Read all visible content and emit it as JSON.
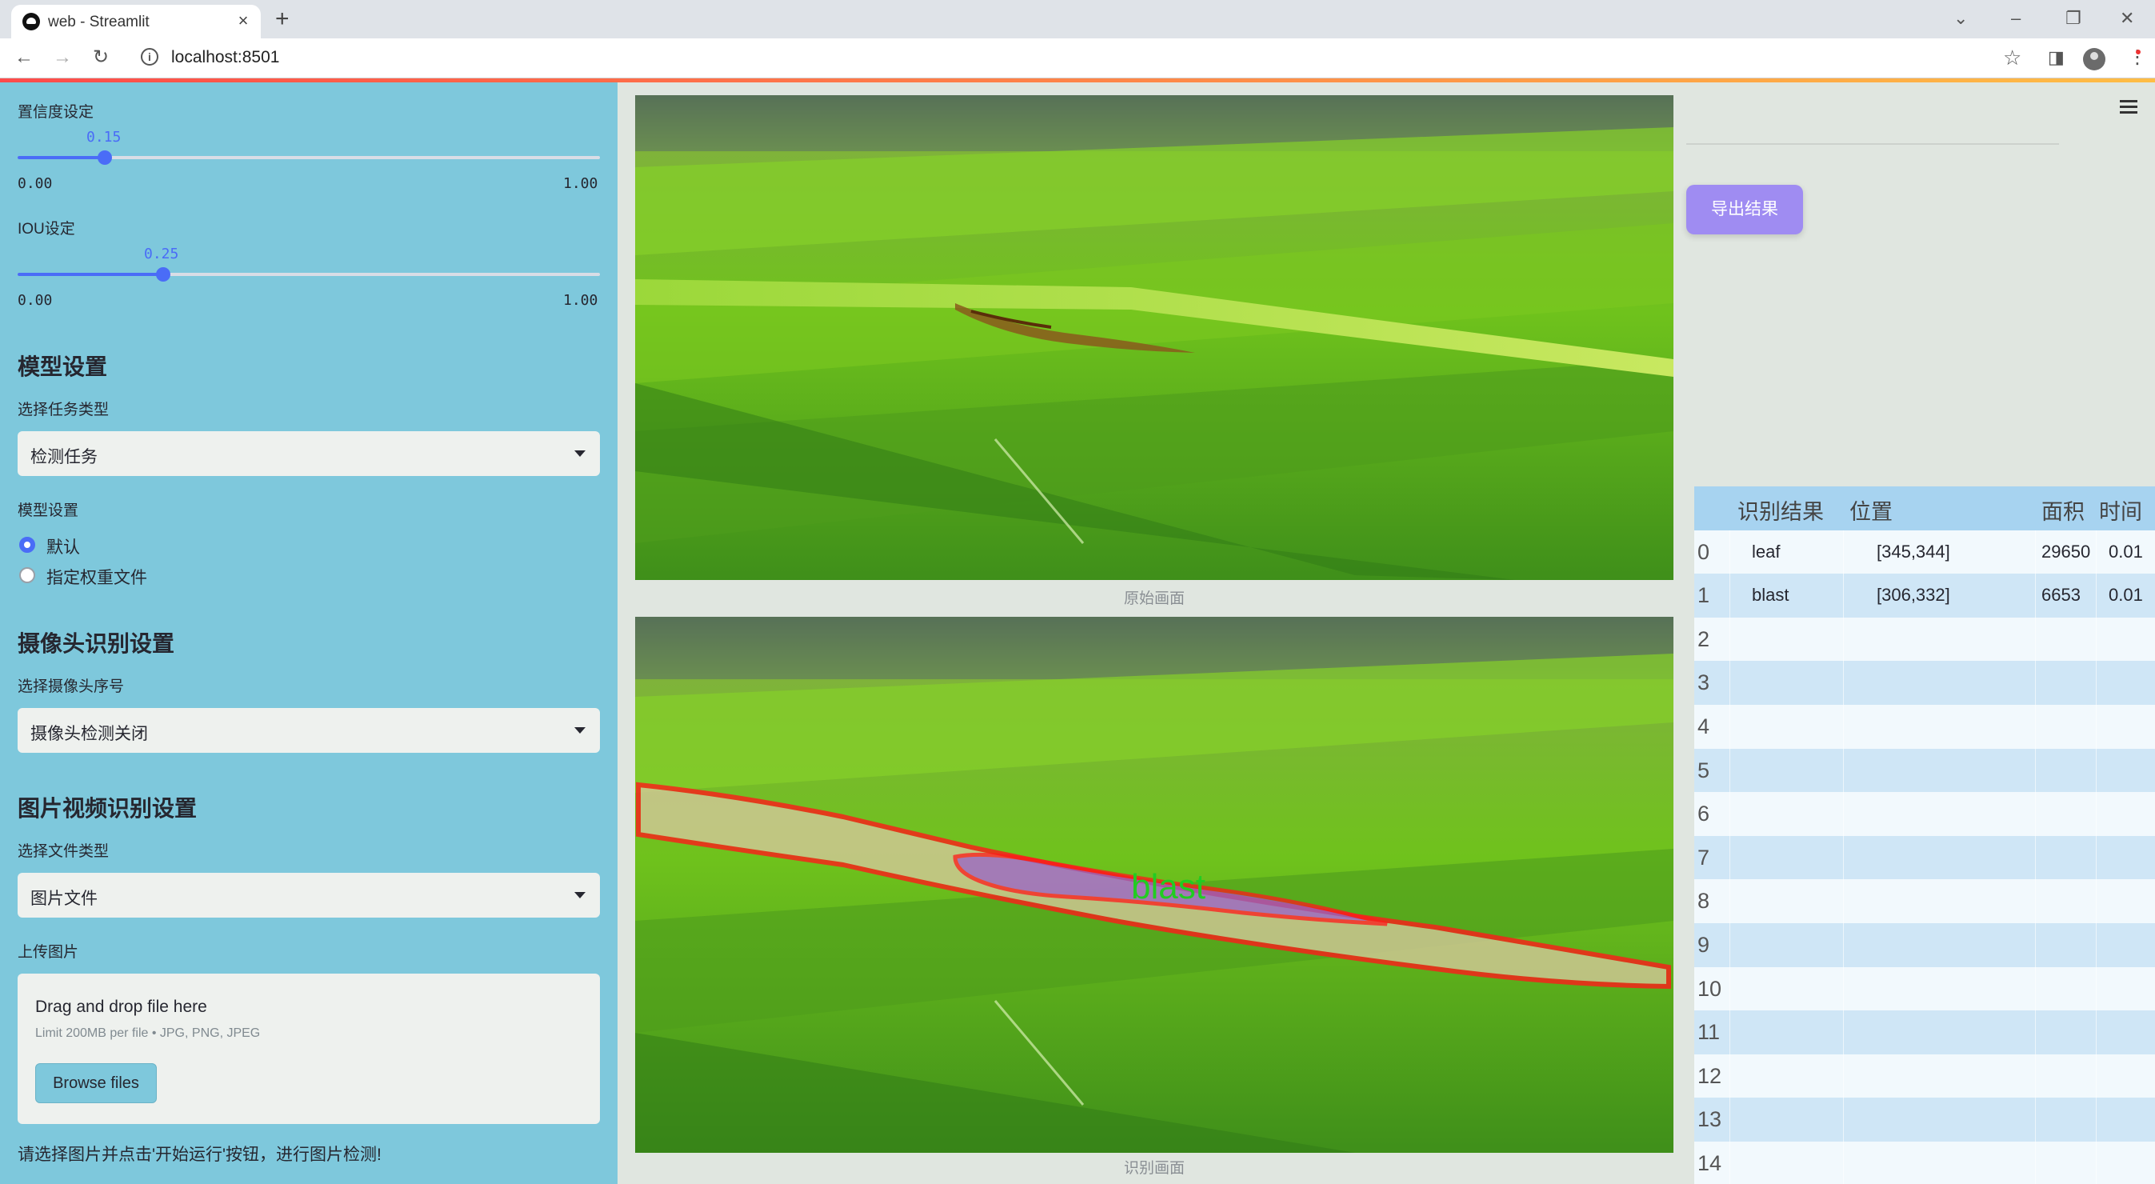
{
  "browser": {
    "tab_title": "web - Streamlit",
    "tab_close": "×",
    "new_tab": "+",
    "url": "localhost:8501",
    "minimize": "–",
    "restore": "❐",
    "close": "✕",
    "tab_list": "⌄"
  },
  "sidebar": {
    "confidence": {
      "label": "置信度设定",
      "value": "0.15",
      "value_fraction": 0.15,
      "min": "0.00",
      "max": "1.00"
    },
    "iou": {
      "label": "IOU设定",
      "value": "0.25",
      "value_fraction": 0.25,
      "min": "0.00",
      "max": "1.00"
    },
    "model_section": "模型设置",
    "task_type_label": "选择任务类型",
    "task_type_value": "检测任务",
    "model_settings_label": "模型设置",
    "model_options": [
      "默认",
      "指定权重文件"
    ],
    "model_selected": "默认",
    "camera_section": "摄像头识别设置",
    "camera_label": "选择摄像头序号",
    "camera_value": "摄像头检测关闭",
    "media_section": "图片视频识别设置",
    "file_type_label": "选择文件类型",
    "file_type_value": "图片文件",
    "upload_label": "上传图片",
    "upload_title": "Drag and drop file here",
    "upload_limit": "Limit 200MB per file • JPG, PNG, JPEG",
    "browse_button": "Browse files",
    "hint": "请选择图片并点击'开始运行'按钮，进行图片检测!"
  },
  "main": {
    "original_caption": "原始画面",
    "result_caption": "识别画面",
    "detection_label": "blast",
    "export_button": "导出结果"
  },
  "results_table": {
    "columns": [
      "",
      "识别结果",
      "位置",
      "面积",
      "时间"
    ],
    "rows": [
      {
        "index": "0",
        "result": "leaf",
        "position": "[345,344]",
        "area": "29650",
        "time": "0.01"
      },
      {
        "index": "1",
        "result": "blast",
        "position": "[306,332]",
        "area": "6653",
        "time": "0.01"
      },
      {
        "index": "2",
        "result": "",
        "position": "",
        "area": "",
        "time": ""
      },
      {
        "index": "3",
        "result": "",
        "position": "",
        "area": "",
        "time": ""
      },
      {
        "index": "4",
        "result": "",
        "position": "",
        "area": "",
        "time": ""
      },
      {
        "index": "5",
        "result": "",
        "position": "",
        "area": "",
        "time": ""
      },
      {
        "index": "6",
        "result": "",
        "position": "",
        "area": "",
        "time": ""
      },
      {
        "index": "7",
        "result": "",
        "position": "",
        "area": "",
        "time": ""
      },
      {
        "index": "8",
        "result": "",
        "position": "",
        "area": "",
        "time": ""
      },
      {
        "index": "9",
        "result": "",
        "position": "",
        "area": "",
        "time": ""
      },
      {
        "index": "10",
        "result": "",
        "position": "",
        "area": "",
        "time": ""
      },
      {
        "index": "11",
        "result": "",
        "position": "",
        "area": "",
        "time": ""
      },
      {
        "index": "12",
        "result": "",
        "position": "",
        "area": "",
        "time": ""
      },
      {
        "index": "13",
        "result": "",
        "position": "",
        "area": "",
        "time": ""
      },
      {
        "index": "14",
        "result": "",
        "position": "",
        "area": "",
        "time": ""
      }
    ]
  },
  "colors": {
    "sidebar_bg": "#7ec8dc",
    "accent": "#4a6cf7",
    "export_button": "#9f8cf2",
    "table_header": "#a7d3f0",
    "table_row_even": "#f2f9fd",
    "table_row_odd": "#cfe6f6",
    "detection_outline": "#ff1a1a",
    "detection_label": "#22cc22"
  },
  "icons": [
    "back-icon",
    "forward-icon",
    "reload-icon",
    "info-icon",
    "star-icon",
    "side-panel-icon",
    "profile-icon",
    "menu-icon",
    "hamburger-icon"
  ]
}
